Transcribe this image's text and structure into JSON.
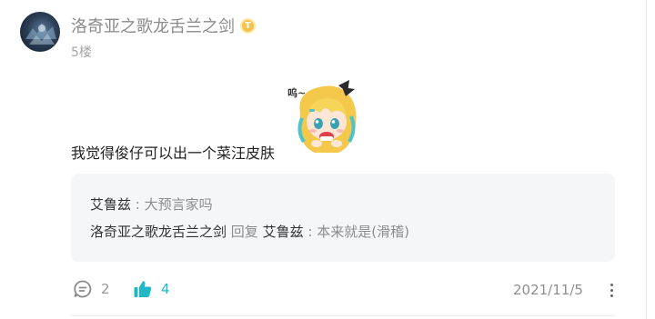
{
  "post": {
    "username": "洛奇亚之歌龙舌兰之剑",
    "badge_letter": "T",
    "floor": "5楼",
    "content": "我觉得俊仔可以出一个菜汪皮肤",
    "sticker": {
      "icon": "anime-girl-sticker",
      "caption": "呜~"
    }
  },
  "replies": [
    {
      "author": "艾鲁兹",
      "separator": ":",
      "text": "大预言家吗"
    },
    {
      "author": "洛奇亚之歌龙舌兰之剑",
      "reply_word": "回复",
      "target": "艾鲁兹",
      "separator": ":",
      "text": "本来就是(滑稽)"
    }
  ],
  "actions": {
    "comment_count": "2",
    "like_count": "4",
    "date": "2021/11/5"
  },
  "colors": {
    "accent": "#1fb8c9",
    "username": "#8b8b8b",
    "reply_bg": "#f5f6f8",
    "badge": "#f2c14e"
  }
}
